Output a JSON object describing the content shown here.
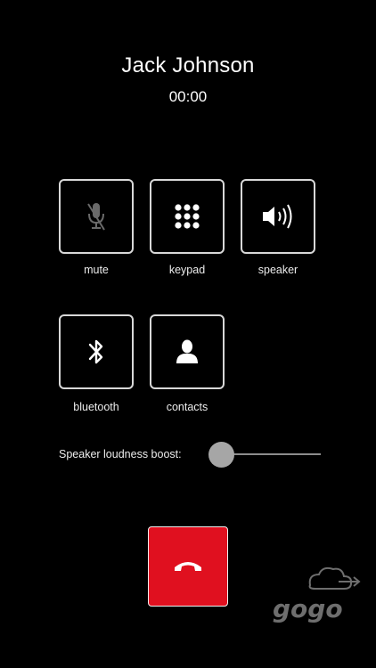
{
  "call": {
    "caller_name": "Jack Johnson",
    "duration": "00:00"
  },
  "controls": [
    {
      "id": "mute",
      "label": "mute",
      "icon": "muted-microphone-icon",
      "enabled": false
    },
    {
      "id": "keypad",
      "label": "keypad",
      "icon": "keypad-grid-icon",
      "enabled": true
    },
    {
      "id": "speaker",
      "label": "speaker",
      "icon": "speaker-volume-icon",
      "enabled": true
    },
    {
      "id": "bluetooth",
      "label": "bluetooth",
      "icon": "bluetooth-icon",
      "enabled": true
    },
    {
      "id": "contacts",
      "label": "contacts",
      "icon": "contact-person-icon",
      "enabled": true
    }
  ],
  "speaker_boost": {
    "label": "Speaker loudness boost:",
    "level": 0
  },
  "end_call": {
    "icon": "end-call-phone-icon",
    "color": "#e0101f"
  },
  "brand": {
    "name": "gogo",
    "icon": "cloud-arrow-icon"
  },
  "theme": {
    "background": "#000000",
    "foreground": "#ffffff",
    "border": "#d8d8d8"
  }
}
